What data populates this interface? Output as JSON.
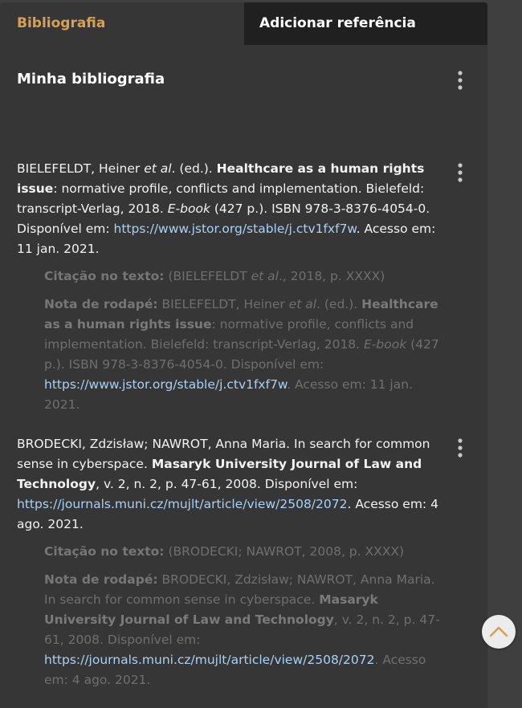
{
  "tabs": {
    "active_label": "Bibliografia",
    "inactive_label": "Adicionar referência"
  },
  "section": {
    "title": "Minha bibliografia"
  },
  "references": [
    {
      "authors": "BIELEFELDT, Heiner ",
      "etal": "et al",
      "ed": ". (ed.). ",
      "title": "Healthcare as a human rights issue",
      "rest1": ": normative profile, conflicts and implementation. Bielefeld: transcript-Verlag, 2018. ",
      "ebook": "E-book",
      "rest2": " (427 p.). ISBN 978-3-8376-4054-0. Disponível em: ",
      "url": "https://www.jstor.org/stable/j.ctv1fxf7w",
      "access": ". Acesso em: 11 jan. 2021.",
      "citation_label": "Citação no texto:",
      "citation_pre": " (BIELEFELDT ",
      "citation_etal": "et al",
      "citation_post": "., 2018, p. XXXX)",
      "footnote_label": "Nota de rodapé:"
    },
    {
      "authors": "BRODECKI, Zdzisław; NAWROT, Anna Maria. In search for common sense in cyberspace. ",
      "journal": "Masaryk University Journal of Law and Technology",
      "rest1": ", v. 2, n. 2, p. 47-61, 2008. Disponível em: ",
      "url": "https://journals.muni.cz/mujlt/article/view/2508/2072",
      "access": ". Acesso em: 4 ago. 2021.",
      "citation_label": "Citação no texto:",
      "citation": " (BRODECKI; NAWROT, 2008, p. XXXX)",
      "footnote_label": "Nota de rodapé:"
    }
  ],
  "colors": {
    "accent": "#d9a04f",
    "link": "#a8d1f5",
    "panel": "#363636"
  },
  "icons": {
    "menu": "kebab-vertical-icon",
    "scroll": "chevron-up-icon"
  }
}
